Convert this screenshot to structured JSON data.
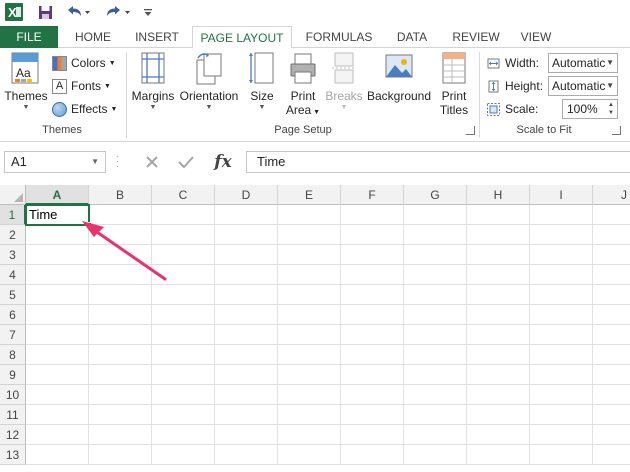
{
  "tabs": [
    "FILE",
    "HOME",
    "INSERT",
    "PAGE LAYOUT",
    "FORMULAS",
    "DATA",
    "REVIEW",
    "VIEW"
  ],
  "active_tab": "PAGE LAYOUT",
  "ribbon": {
    "themes_group": {
      "themes_label": "Themes",
      "colors_label": "Colors",
      "fonts_label": "Fonts",
      "effects_label": "Effects",
      "group_label": "Themes"
    },
    "page_setup_group": {
      "margins_label": "Margins",
      "orientation_label": "Orientation",
      "size_label": "Size",
      "print_area_label_1": "Print",
      "print_area_label_2": "Area",
      "breaks_label": "Breaks",
      "background_label": "Background",
      "print_titles_label_1": "Print",
      "print_titles_label_2": "Titles",
      "group_label": "Page Setup"
    },
    "scale_group": {
      "width_label": "Width:",
      "width_value": "Automatic",
      "height_label": "Height:",
      "height_value": "Automatic",
      "scale_label": "Scale:",
      "scale_value": "100%",
      "group_label": "Scale to Fit"
    }
  },
  "formula_bar": {
    "name_box": "A1",
    "fx_label": "fx",
    "content": "Time"
  },
  "grid": {
    "columns": [
      "A",
      "B",
      "C",
      "D",
      "E",
      "F",
      "G",
      "H",
      "I",
      "J"
    ],
    "rows": [
      "1",
      "2",
      "3",
      "4",
      "5",
      "6",
      "7",
      "8",
      "9",
      "10",
      "11",
      "12",
      "13"
    ],
    "cell_A1": "Time",
    "selected_cell": "A1"
  },
  "colors": {
    "accent_green": "#217346",
    "arrow_pink": "#e8336e"
  }
}
